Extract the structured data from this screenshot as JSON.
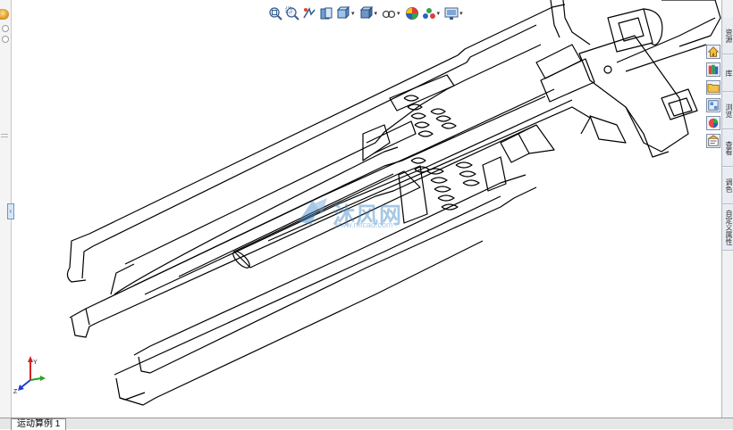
{
  "toolbar": {
    "items": [
      {
        "name": "zoom-to-fit-icon",
        "dropdown": false
      },
      {
        "name": "zoom-area-icon",
        "dropdown": false
      },
      {
        "name": "previous-view-icon",
        "dropdown": false
      },
      {
        "name": "section-view-icon",
        "dropdown": false
      },
      {
        "name": "view-orientation-icon",
        "dropdown": true
      },
      {
        "name": "display-style-icon",
        "dropdown": true
      },
      {
        "name": "hide-show-items-icon",
        "dropdown": true
      },
      {
        "name": "edit-appearance-icon",
        "dropdown": false
      },
      {
        "name": "apply-scene-icon",
        "dropdown": true
      },
      {
        "name": "view-settings-icon",
        "dropdown": true
      }
    ],
    "dropdown_glyph": "▾"
  },
  "task_pane": {
    "tabs": [
      "资源",
      "库",
      "浏览",
      "查看",
      "调色",
      "自定义属性"
    ],
    "icons": [
      "home-icon",
      "design-library-icon",
      "file-explorer-icon",
      "view-palette-icon",
      "appearances-icon",
      "custom-properties-icon"
    ]
  },
  "status_bar": {
    "tab_label": "运动算例 1"
  },
  "triad": {
    "x_label": "",
    "y_label": "Y",
    "z_label": "Z"
  },
  "watermark": {
    "brand": "沐风网",
    "url": "www.mfcad.com"
  },
  "colors": {
    "accent": "#3c86c9",
    "line": "#000000",
    "panel": "#f1f1f1"
  }
}
